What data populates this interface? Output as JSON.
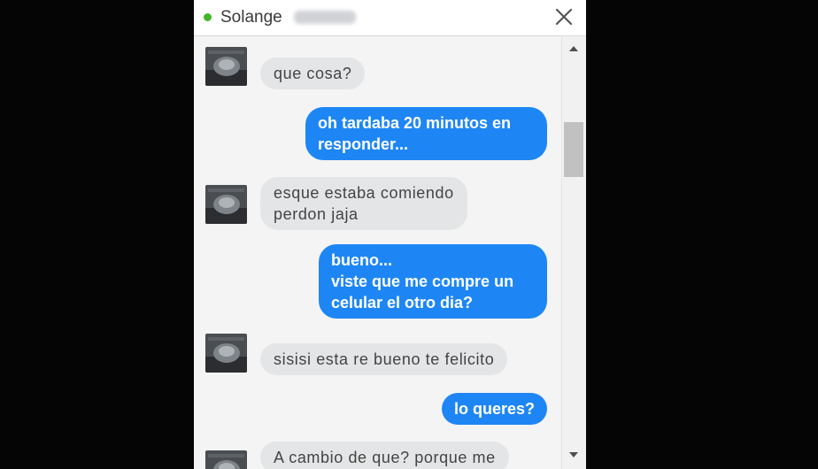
{
  "header": {
    "name": "Solange",
    "status_color": "#42b72a",
    "close_icon": "close-icon"
  },
  "messages": [
    {
      "dir": "in",
      "text": "que cosa?"
    },
    {
      "dir": "out",
      "text": "oh tardaba 20 minutos en\nresponder..."
    },
    {
      "dir": "in",
      "text": "esque estaba comiendo\nperdon jaja"
    },
    {
      "dir": "out",
      "text": "bueno...\nviste que me compre un\ncelular el otro dia?"
    },
    {
      "dir": "in",
      "text": "sisisi esta re bueno te felicito"
    },
    {
      "dir": "out",
      "text": "lo queres?"
    },
    {
      "dir": "in",
      "text": "A cambio de que? porque me"
    }
  ],
  "colors": {
    "outgoing_bubble": "#1e86f4",
    "incoming_bubble": "#e4e5e6"
  }
}
